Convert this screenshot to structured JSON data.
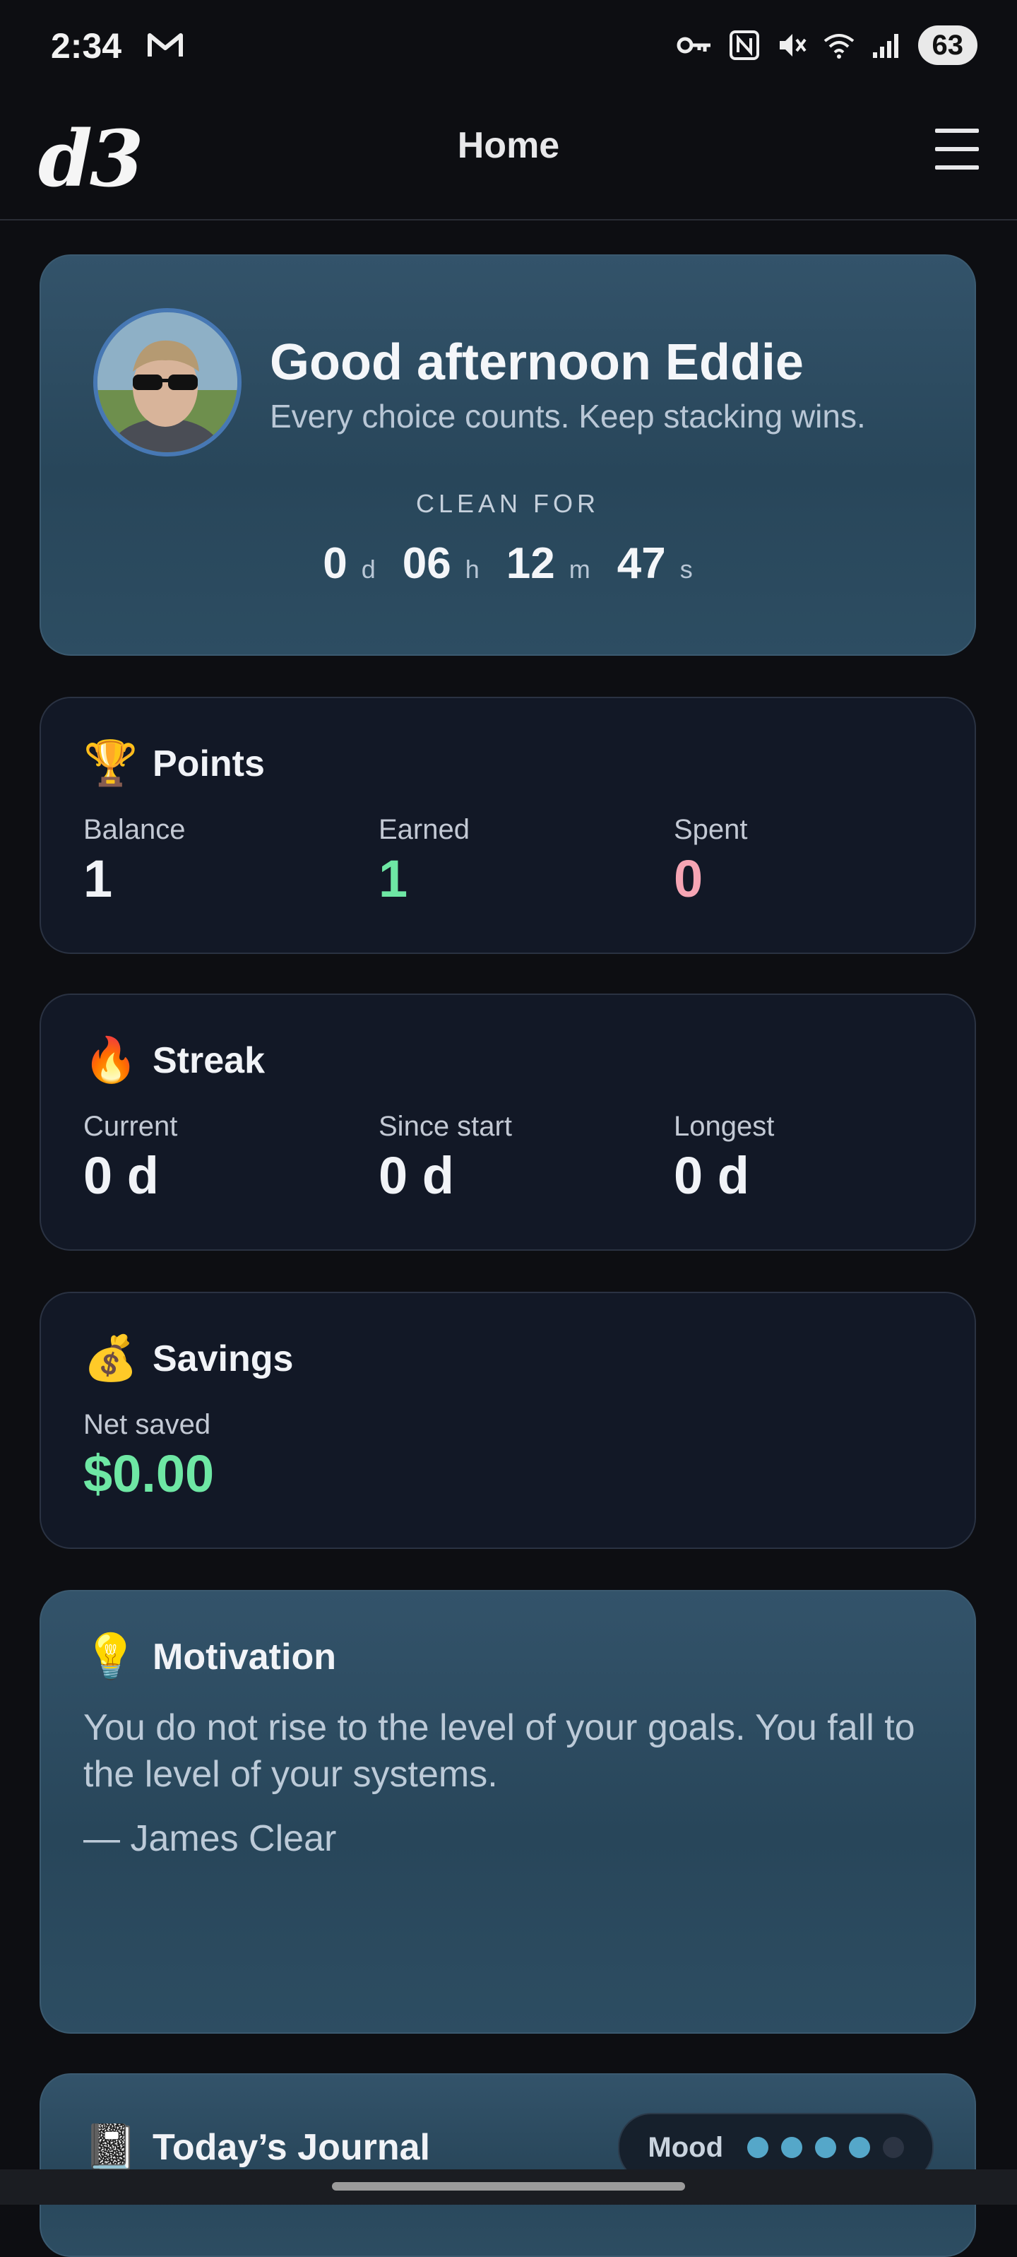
{
  "status_bar": {
    "time": "2:34",
    "battery": "63",
    "icons": [
      "mail-icon",
      "key-icon",
      "nfc-icon",
      "mute-icon",
      "wifi-icon",
      "signal-icon"
    ]
  },
  "app_bar": {
    "logo": "d3",
    "title": "Home",
    "menu_icon": "hamburger-menu-icon"
  },
  "hero": {
    "greeting": "Good afternoon Eddie",
    "subtitle": "Every choice counts. Keep stacking wins.",
    "clean_label": "CLEAN FOR",
    "timer": {
      "days": "0",
      "days_unit": "d",
      "hours": "06",
      "hours_unit": "h",
      "minutes": "12",
      "minutes_unit": "m",
      "seconds": "47",
      "seconds_unit": "s"
    }
  },
  "points": {
    "icon": "🏆",
    "title": "Points",
    "balance_label": "Balance",
    "balance": "1",
    "earned_label": "Earned",
    "earned": "1",
    "spent_label": "Spent",
    "spent": "0"
  },
  "streak": {
    "icon": "🔥",
    "title": "Streak",
    "current_label": "Current",
    "current": "0 d",
    "since_start_label": "Since start",
    "since_start": "0 d",
    "longest_label": "Longest",
    "longest": "0 d"
  },
  "savings": {
    "icon": "💰",
    "title": "Savings",
    "net_saved_label": "Net saved",
    "net_saved": "$0.00"
  },
  "motivation": {
    "icon": "💡",
    "title": "Motivation",
    "quote": "You do not rise to the level of your goals. You fall to the level of your systems.",
    "author": "— James Clear"
  },
  "journal": {
    "icon": "📓",
    "title": "Today’s Journal",
    "mood_label": "Mood",
    "mood_level": 4,
    "mood_max": 5
  },
  "colors": {
    "background": "#0d0e12",
    "card_dark": "#121826",
    "card_blue": "#33536a",
    "earned_green": "#6ee7a4",
    "spent_pink": "#f6a5b4",
    "mood_dot": "#55a7c9"
  }
}
